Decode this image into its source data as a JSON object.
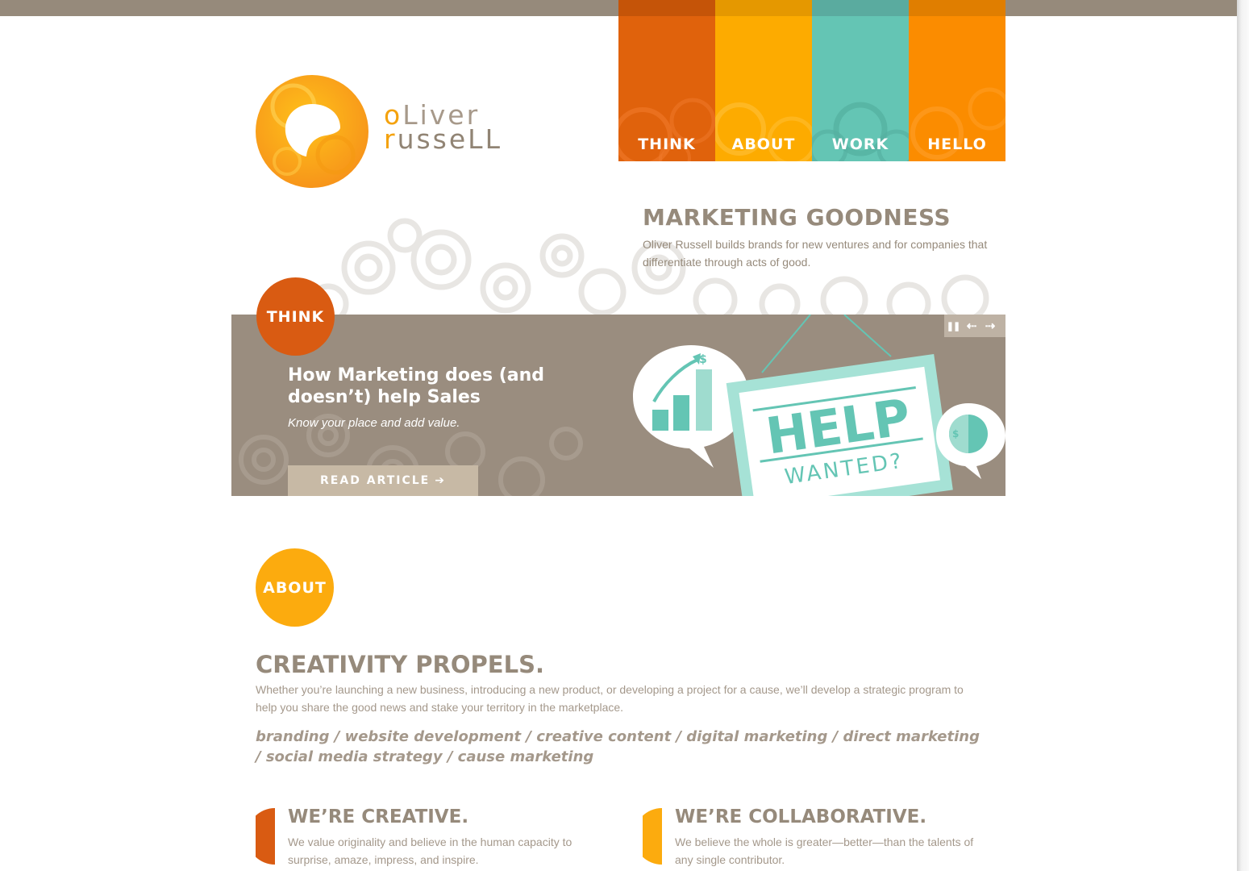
{
  "colors": {
    "brand_orange": "#d95b12",
    "brand_yellow": "#fcab0e",
    "brand_teal": "#64c5b4",
    "brand_amber": "#fb8c00",
    "taupe": "#968a7b"
  },
  "logo": {
    "line1_first": "o",
    "line1_rest": "Liver",
    "line2_first": "r",
    "line2_rest": "usseLL"
  },
  "nav": {
    "items": [
      {
        "label": "THINK"
      },
      {
        "label": "ABOUT"
      },
      {
        "label": "WORK"
      },
      {
        "label": "HELLO"
      }
    ]
  },
  "hero": {
    "title": "MARKETING GOODNESS",
    "text": "Oliver Russell builds brands for new ventures and for companies that differentiate through acts of good."
  },
  "think": {
    "badge": "THINK",
    "slide_title": "How Marketing does (and doesn’t) help Sales",
    "slide_subtitle": "Know your place and add value.",
    "button_label": "READ ARTICLE",
    "button_icon": "arrow-right-icon",
    "art": {
      "sign_title": "HELP",
      "sign_subtitle": "WANTED?",
      "currency_symbol": "$"
    },
    "controls": {
      "pause_icon": "pause-icon",
      "prev_icon": "arrow-left-icon",
      "next_icon": "arrow-right-icon"
    }
  },
  "about": {
    "badge": "ABOUT",
    "title": "CREATIVITY PROPELS.",
    "text": "Whether you’re launching a new business, introducing a new product, or developing a project for a cause, we’ll develop a strategic program to help you share the good news and stake your territory in the marketplace.",
    "services": "branding / website development / creative content / digital marketing / direct marketing / social media strategy / cause marketing",
    "columns": [
      {
        "title": "WE’RE CREATIVE.",
        "text": "We value originality and believe in the human capacity to surprise, amaze, impress, and inspire."
      },
      {
        "title": "WE’RE COLLABORATIVE.",
        "text": "We believe the whole is greater—better—than the talents of any single contributor."
      }
    ]
  }
}
